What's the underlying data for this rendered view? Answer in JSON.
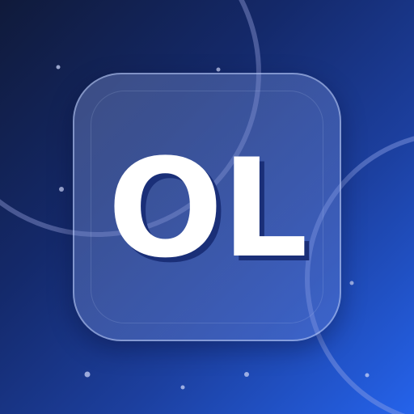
{
  "icon": {
    "monogram": "OL"
  },
  "colors": {
    "background_start": "#101a3a",
    "background_end": "#2563eb",
    "text": "#ffffff",
    "text_shadow": "#1a2f78"
  }
}
